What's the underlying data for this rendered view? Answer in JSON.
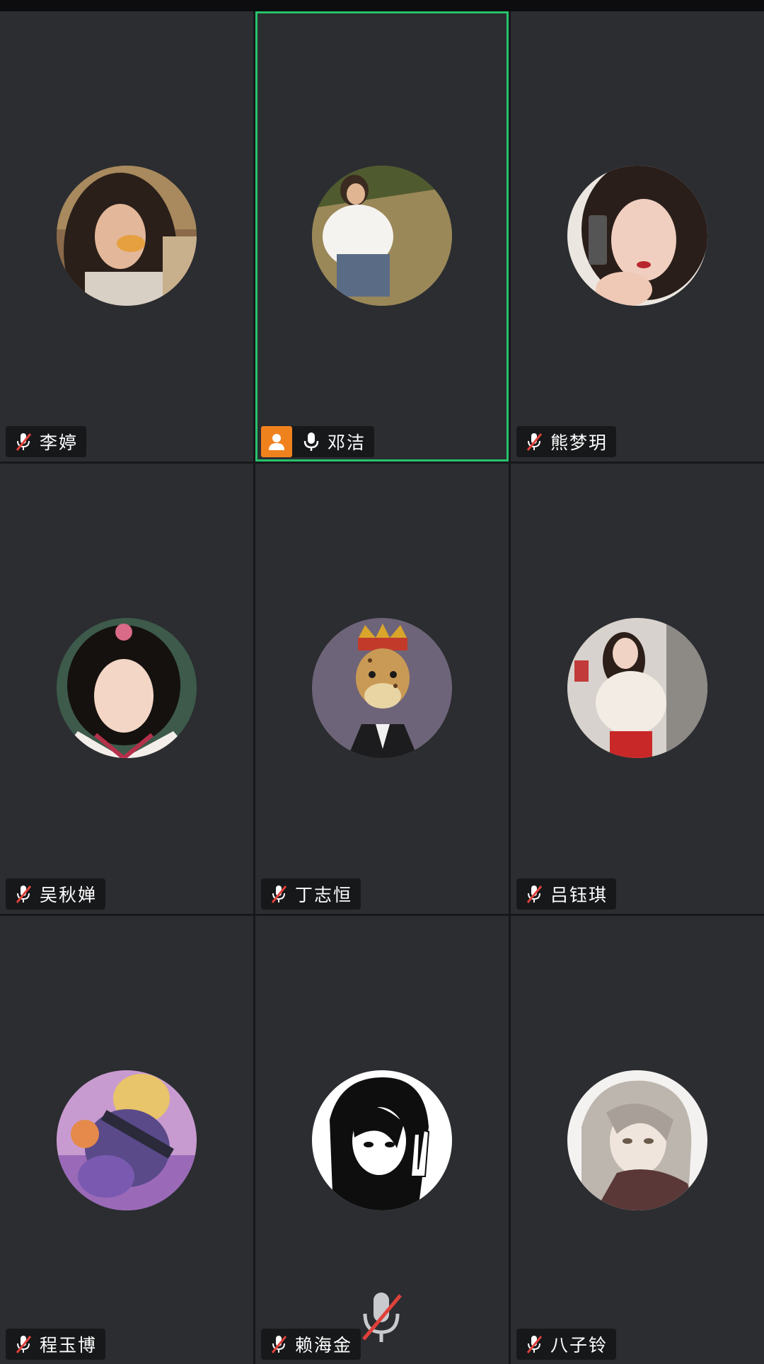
{
  "participants": [
    {
      "name": "李婷",
      "muted": true,
      "host": false,
      "active": false,
      "avatar": "portrait-photo-icon"
    },
    {
      "name": "邓洁",
      "muted": false,
      "host": true,
      "active": true,
      "avatar": "portrait-photo-icon"
    },
    {
      "name": "熊梦玥",
      "muted": true,
      "host": false,
      "active": false,
      "avatar": "portrait-photo-icon"
    },
    {
      "name": "吴秋婵",
      "muted": true,
      "host": false,
      "active": false,
      "avatar": "portrait-photo-icon"
    },
    {
      "name": "丁志恒",
      "muted": true,
      "host": false,
      "active": false,
      "avatar": "cartoon-ape-icon"
    },
    {
      "name": "吕钰琪",
      "muted": true,
      "host": false,
      "active": false,
      "avatar": "portrait-photo-icon"
    },
    {
      "name": "程玉博",
      "muted": true,
      "host": false,
      "active": false,
      "avatar": "game-character-icon"
    },
    {
      "name": "赖海金",
      "muted": true,
      "host": false,
      "active": false,
      "avatar": "manga-character-icon"
    },
    {
      "name": "八子铃",
      "muted": true,
      "host": false,
      "active": false,
      "avatar": "anime-character-icon"
    }
  ],
  "colors": {
    "tile_bg": "#2b2d31",
    "active_border": "#27c26b",
    "host_badge": "#f0821e",
    "mute_slash": "#e0413b"
  }
}
